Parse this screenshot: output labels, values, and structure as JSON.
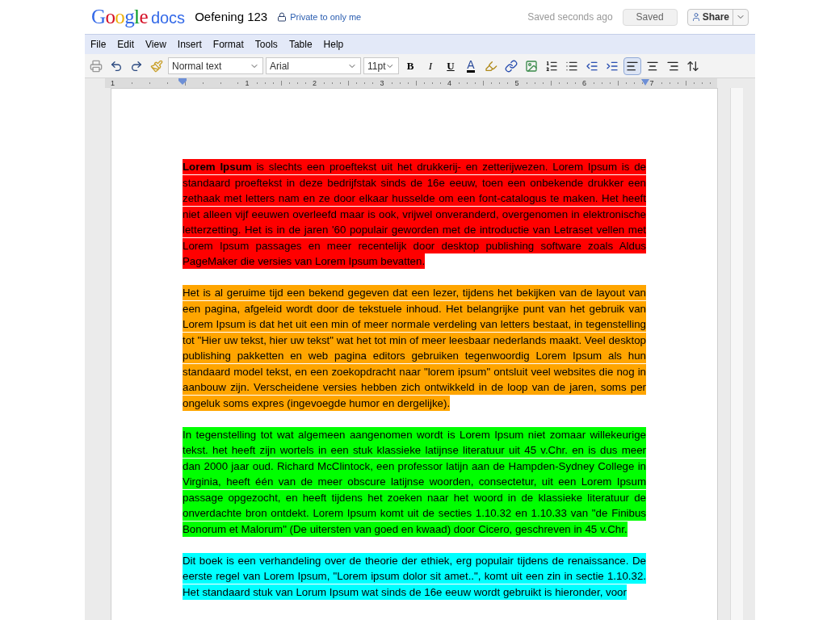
{
  "header": {
    "logo_google": "Google",
    "logo_docs": "docs",
    "doc_title": "Oefening 123",
    "privacy": "Private to only me",
    "save_status": "Saved seconds ago",
    "saved_button": "Saved",
    "share_button": "Share"
  },
  "menu": [
    "File",
    "Edit",
    "View",
    "Insert",
    "Format",
    "Tools",
    "Table",
    "Help"
  ],
  "toolbar": {
    "style": "Normal text",
    "font": "Arial",
    "size": "11pt",
    "bold": "B",
    "italic": "I",
    "underline": "U",
    "text_color": "A",
    "alignment": [
      {
        "kind": "left",
        "selected": true
      },
      {
        "kind": "center",
        "selected": false
      },
      {
        "kind": "right",
        "selected": false
      }
    ]
  },
  "ruler": {
    "labels": [
      "1",
      "1",
      "2",
      "3",
      "4",
      "5",
      "6",
      "7"
    ]
  },
  "paragraphs": [
    {
      "color": "#ff0000",
      "text": "**Lorem Ipsum** is slechts een proeftekst uit het drukkerij- en zetterijwezen. Lorem Ipsum is de standaard proeftekst in deze bedrijfstak sinds de 16e eeuw, toen een onbekende drukker een zethaak met letters nam en ze door elkaar husselde om een font-catalogus te maken. Het heeft niet alleen vijf eeuwen overleefd maar is ook, vrijwel onveranderd, overgenomen in elektronische letterzetting. Het is in de jaren '60 populair geworden met de introductie van Letraset vellen met Lorem Ipsum passages en meer recentelijk door desktop publishing software zoals Aldus PageMaker die versies van Lorem Ipsum bevatten."
    },
    {
      "color": "#ffa500",
      "text": "Het is al geruime tijd een bekend gegeven dat een lezer, tijdens het bekijken van de layout van een pagina, afgeleid wordt door de tekstuele inhoud. Het belangrijke punt van het gebruik van Lorem Ipsum is dat het uit een min of meer normale verdeling van letters bestaat, in tegenstelling tot \"Hier uw tekst, hier uw tekst\" wat het tot min of meer leesbaar nederlands maakt. Veel desktop publishing pakketten en web pagina editors gebruiken tegenwoordig Lorem Ipsum als hun standaard model tekst, en een zoekopdracht naar \"lorem ipsum\" ontsluit veel websites die nog in aanbouw zijn. Verscheidene versies hebben zich ontwikkeld in de loop van de jaren, soms per ongeluk soms expres (ingevoegde humor en dergelijke)."
    },
    {
      "color": "#00ff00",
      "text": "In tegenstelling tot wat algemeen aangenomen wordt is Lorem Ipsum niet zomaar willekeurige tekst. het heeft zijn wortels in een stuk klassieke latijnse literatuur uit 45 v.Chr. en is dus meer dan 2000 jaar oud. Richard McClintock, een professor latijn aan de Hampden-Sydney College in Virginia, heeft één van de meer obscure latijnse woorden, consectetur, uit een Lorem Ipsum passage opgezocht, en heeft tijdens het zoeken naar het woord in de klassieke literatuur de onverdachte bron ontdekt. Lorem Ipsum komt uit de secties 1.10.32 en 1.10.33 van \"de Finibus Bonorum et Malorum\" (De uitersten van goed en kwaad) door Cicero, geschreven in 45 v.Chr."
    },
    {
      "color": "#00ffff",
      "text": "Dit boek is een verhandeling over de theorie der ethiek, erg populair tijdens de renaissance. De eerste regel van Lorem Ipsum, \"Lorem ipsum dolor sit amet..\", komt uit een zin in sectie 1.10.32. Het standaard stuk van Lorum Ipsum wat sinds de 16e eeuw wordt gebruikt is hieronder, voor"
    }
  ]
}
